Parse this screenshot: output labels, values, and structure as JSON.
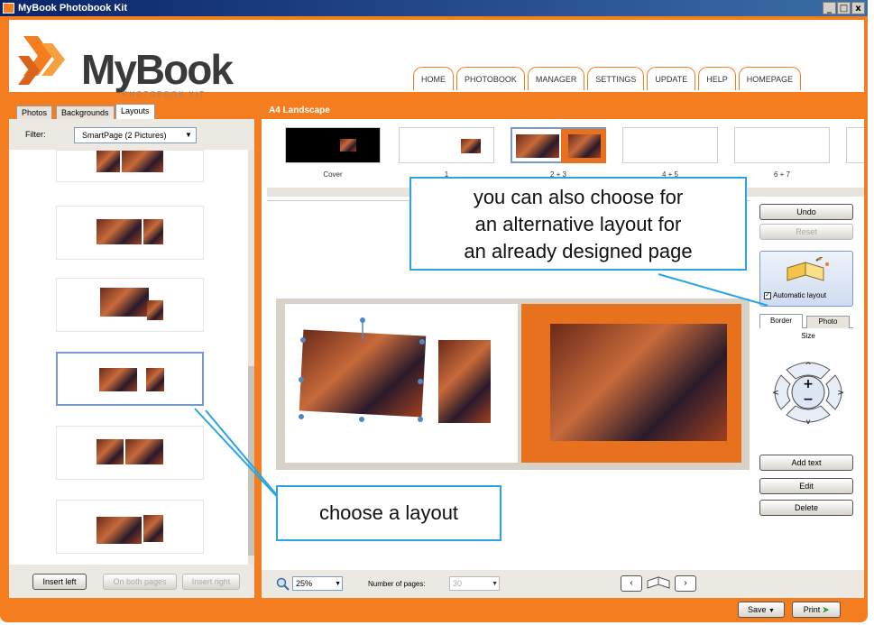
{
  "window": {
    "title": "MyBook Photobook Kit",
    "controls": [
      "_",
      "□",
      "x"
    ]
  },
  "header": {
    "logo_text": "MyBook",
    "logo_sub": "PHOTOBOOK KIT",
    "nav": [
      "HOME",
      "PHOTOBOOK",
      "MANAGER",
      "SETTINGS",
      "UPDATE",
      "HELP",
      "HOMEPAGE"
    ]
  },
  "left_panel": {
    "tabs": [
      "Photos",
      "Backgrounds",
      "Layouts"
    ],
    "active_tab": "Layouts",
    "filter_label": "Filter:",
    "filter_value": "SmartPage (2 Pictures)",
    "buttons": {
      "insert_left": "Insert left",
      "on_both_pages": "On both pages",
      "insert_right": "Insert right"
    }
  },
  "right_panel": {
    "title": "A4 Landscape",
    "spreads": [
      "Cover",
      "1",
      "2 + 3",
      "4 + 5",
      "6 + 7"
    ],
    "selected_spread": "2 + 3",
    "side": {
      "undo": "Undo",
      "reset": "Reset",
      "automatic_layout": "Automatic layout",
      "automatic_layout_checked": true,
      "tabs": [
        "Border",
        "Photo"
      ],
      "size_label": "Size",
      "add_text": "Add text",
      "edit": "Edit",
      "delete": "Delete"
    },
    "bottom": {
      "zoom": "25%",
      "pages_label": "Number of pages:",
      "pages_value": "30"
    }
  },
  "footer": {
    "save": "Save",
    "print": "Print"
  },
  "callouts": {
    "alternative_layout": [
      "you can also choose for",
      "an alternative layout for",
      "an already designed page"
    ],
    "choose_layout": "choose a layout"
  },
  "colors": {
    "brand_orange": "#f47d20",
    "callout_blue": "#29a5e0",
    "title_bar": "#0a246a"
  }
}
